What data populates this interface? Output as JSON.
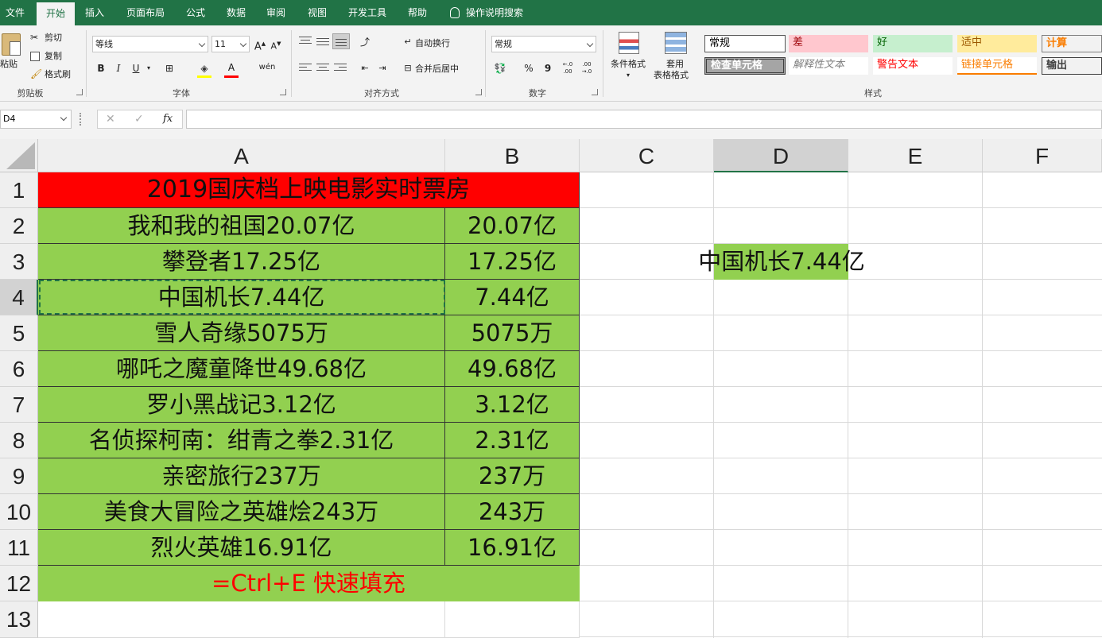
{
  "menu": {
    "tabs": [
      "文件",
      "开始",
      "插入",
      "页面布局",
      "公式",
      "数据",
      "审阅",
      "视图",
      "开发工具",
      "帮助"
    ],
    "search_label": "操作说明搜索"
  },
  "ribbon": {
    "clipboard": {
      "paste": "粘贴",
      "cut": "剪切",
      "copy": "复制",
      "format_painter": "格式刷",
      "label": "剪贴板"
    },
    "font": {
      "name": "等线",
      "size": "11",
      "bold": "B",
      "italic": "I",
      "underline": "U",
      "font_color_glyph": "A",
      "phonetic": "wén",
      "label": "字体"
    },
    "alignment": {
      "wrap": "自动换行",
      "merge": "合并后居中",
      "label": "对齐方式"
    },
    "number": {
      "format": "常规",
      "percent": "%",
      "comma": "9",
      "inc_decimal": "←.0 .00",
      "dec_decimal": ".00 →.0",
      "label": "数字"
    },
    "styles": {
      "conditional": "条件格式",
      "table_format_1": "套用",
      "table_format_2": "表格格式",
      "label": "样式",
      "gallery": [
        {
          "text": "常规",
          "bg": "#ffffff",
          "color": "#000000"
        },
        {
          "text": "差",
          "bg": "#ffc7ce",
          "color": "#9c0006"
        },
        {
          "text": "好",
          "bg": "#c6efce",
          "color": "#006100"
        },
        {
          "text": "适中",
          "bg": "#ffeb9c",
          "color": "#9c5700"
        },
        {
          "text": "计算",
          "bg": "#f2f2f2",
          "color": "#fa7d00"
        },
        {
          "text": "检查单元格",
          "bg": "#a5a5a5",
          "color": "#ffffff"
        },
        {
          "text": "解释性文本",
          "bg": "#ffffff",
          "color": "#7f7f7f"
        },
        {
          "text": "警告文本",
          "bg": "#ffffff",
          "color": "#ff0000"
        },
        {
          "text": "链接单元格",
          "bg": "#ffffff",
          "color": "#fa7d00"
        },
        {
          "text": "输出",
          "bg": "#f2f2f2",
          "color": "#3f3f3f"
        }
      ]
    }
  },
  "formula_bar": {
    "name_box": "D4",
    "cancel": "✕",
    "enter": "✓",
    "fx": "fx",
    "value": ""
  },
  "sheet": {
    "columns": [
      "A",
      "B",
      "C",
      "D",
      "E",
      "F"
    ],
    "rows": [
      "1",
      "2",
      "3",
      "4",
      "5",
      "6",
      "7",
      "8",
      "9",
      "10",
      "11",
      "12",
      "13"
    ],
    "title": "2019国庆档上映电影实时票房",
    "entries": [
      {
        "a": "我和我的祖国20.07亿",
        "b": "20.07亿"
      },
      {
        "a": "攀登者17.25亿",
        "b": "17.25亿"
      },
      {
        "a": "中国机长7.44亿",
        "b": "7.44亿"
      },
      {
        "a": "雪人奇缘5075万",
        "b": "5075万"
      },
      {
        "a": "哪吒之魔童降世49.68亿",
        "b": "49.68亿"
      },
      {
        "a": "罗小黑战记3.12亿",
        "b": "3.12亿"
      },
      {
        "a": "名侦探柯南：绀青之拳2.31亿",
        "b": "2.31亿"
      },
      {
        "a": "亲密旅行237万",
        "b": "237万"
      },
      {
        "a": "美食大冒险之英雄烩243万",
        "b": "243万"
      },
      {
        "a": "烈火英雄16.91亿",
        "b": "16.91亿"
      }
    ],
    "footer": "=Ctrl+E 快速填充",
    "d3": "中国机长7.44亿",
    "colors": {
      "title_bg": "#ff0000",
      "data_bg": "#92d050",
      "footer_text": "#ff0000",
      "accent": "#217346"
    }
  }
}
